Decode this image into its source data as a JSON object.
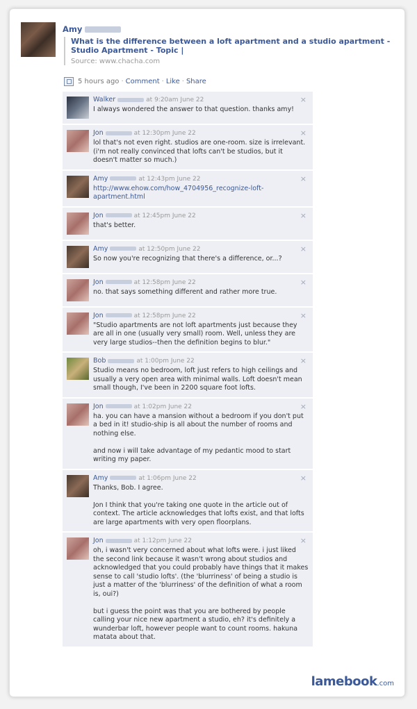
{
  "post": {
    "author": "Amy",
    "title": "What is the difference between a loft apartment and a studio apartment - Studio Apartment - Topic |",
    "source": "Source: www.chacha.com",
    "time": "5 hours ago",
    "comment_label": "Comment",
    "like_label": "Like",
    "share_label": "Share"
  },
  "comments": [
    {
      "name": "Walker",
      "time": "at 9:20am June 22",
      "text": "I always wondered the answer to that question. thanks amy!"
    },
    {
      "name": "Jon",
      "time": "at 12:30pm June 22",
      "text": "lol that's not even right. studios are one-room. size is irrelevant. (i'm not really convinced that lofts can't be studios, but it doesn't matter so much.)"
    },
    {
      "name": "Amy",
      "time": "at 12:43pm June 22",
      "text": "http://www.ehow.com/how_4704956_recognize-loft-apartment.html"
    },
    {
      "name": "Jon",
      "time": "at 12:45pm June 22",
      "text": "that's better."
    },
    {
      "name": "Amy",
      "time": "at 12:50pm June 22",
      "text": "So now you're recognizing that there's a difference, or...?"
    },
    {
      "name": "Jon",
      "time": "at 12:58pm June 22",
      "text": "no. that says something different and rather more true."
    },
    {
      "name": "Jon",
      "time": "at 12:58pm June 22",
      "text": "\"Studio apartments are not loft apartments just because they are all in one (usually very small) room. Well, unless they are very large studios--then the definition begins to blur.\""
    },
    {
      "name": "Bob",
      "time": "at 1:00pm June 22",
      "text": "Studio means no bedroom, loft just refers to high ceilings and usually a very open area with minimal walls. Loft doesn't mean small though, I've been in 2200 square foot lofts."
    },
    {
      "name": "Jon",
      "time": "at 1:02pm June 22",
      "text": "ha. you can have a mansion without a bedroom if you don't put a bed in it! studio-ship is all about the number of rooms and nothing else.\n\nand now i will take advantage of my pedantic mood to start writing my paper."
    },
    {
      "name": "Amy",
      "time": "at 1:06pm June 22",
      "text": "Thanks, Bob. I agree.\n\nJon I think that you're taking one quote in the article out of context. The article acknowledges that lofts exist, and that lofts are large apartments with very open floorplans."
    },
    {
      "name": "Jon",
      "time": "at 1:12pm June 22",
      "text": "oh, i wasn't very concerned about what lofts were. i just liked the second link because it wasn't wrong about studios and acknowledged that you could probably have things that it makes sense to call 'studio lofts'. (the 'blurriness' of being a studio is just a matter of the 'blurriness' of the definition of what a room is, oui?)\n\nbut i guess the point was that you are bothered by people calling your nice new apartment a studio, eh? it's definitely a wunderbar loft, however people want to count rooms. hakuna matata about that."
    }
  ],
  "close_glyph": "×",
  "brand": {
    "name": "lamebook",
    "domain": ".com"
  }
}
